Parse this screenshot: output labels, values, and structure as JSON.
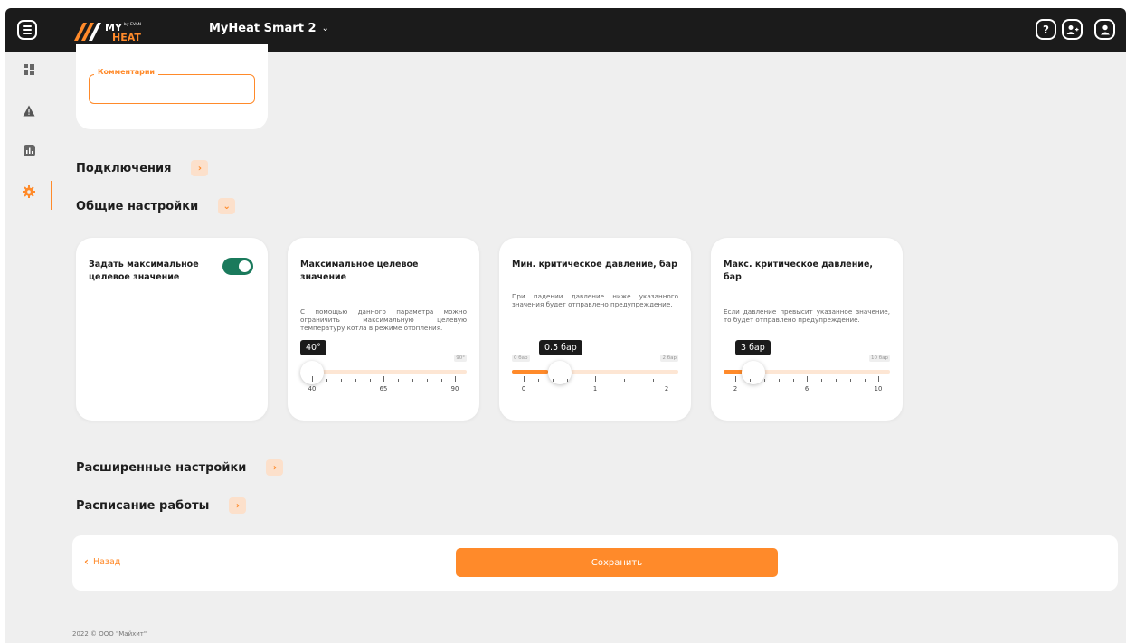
{
  "header": {
    "logo_text": "MY HEAT by EVAN",
    "device_name": "MyHeat Smart 2",
    "icons": [
      "menu-icon",
      "help-icon",
      "add-user-icon",
      "user-icon"
    ],
    "help_glyph": "?",
    "colors": {
      "bar": "#1b1b1b",
      "accent": "#ff8a2a"
    }
  },
  "sidebar": {
    "items": [
      {
        "icon": "dashboard-icon"
      },
      {
        "icon": "warning-icon"
      },
      {
        "icon": "chart-icon"
      },
      {
        "icon": "gear-icon",
        "active": true
      }
    ]
  },
  "comment": {
    "label": "Комментарии",
    "value": ""
  },
  "sections": {
    "connections": "Подключения",
    "general": "Общие настройки",
    "advanced": "Расширенные настройки",
    "schedule": "Расписание работы"
  },
  "cards": {
    "max_toggle": {
      "title": "Задать максимальное целевое значение",
      "enabled": true
    },
    "max_target": {
      "title": "Максимальное целевое значение",
      "description": "С помощью данного параметра можно ограничить максимальную целевую температуру котла в режиме отопления.",
      "value": 40,
      "tooltip": "40°",
      "min": 40,
      "max": 90,
      "right_edge_label": "90°",
      "tick_labels": [
        "40",
        "65",
        "90"
      ]
    },
    "min_pressure": {
      "title": "Мин. критическое давление, бар",
      "description": "При падении давление ниже указанного значения будет отправлено предупреждение.",
      "value": 0.5,
      "tooltip": "0.5 бар",
      "min": 0,
      "max": 2,
      "left_edge_label": "0 бар",
      "right_edge_label": "2 бар",
      "tick_labels": [
        "0",
        "1",
        "2"
      ]
    },
    "max_pressure": {
      "title": "Макс. критическое давление, бар",
      "description": "Если давление превысит указанное значение, то будет отправлено предупреждение.",
      "value": 3,
      "tooltip": "3 бар",
      "min": 2,
      "max": 10,
      "right_edge_label": "10 бар",
      "tick_labels": [
        "2",
        "6",
        "10"
      ]
    }
  },
  "actions": {
    "back": "Назад",
    "save": "Сохранить"
  },
  "footer": {
    "copyright": "2022 © ООО \"Майхит\""
  }
}
